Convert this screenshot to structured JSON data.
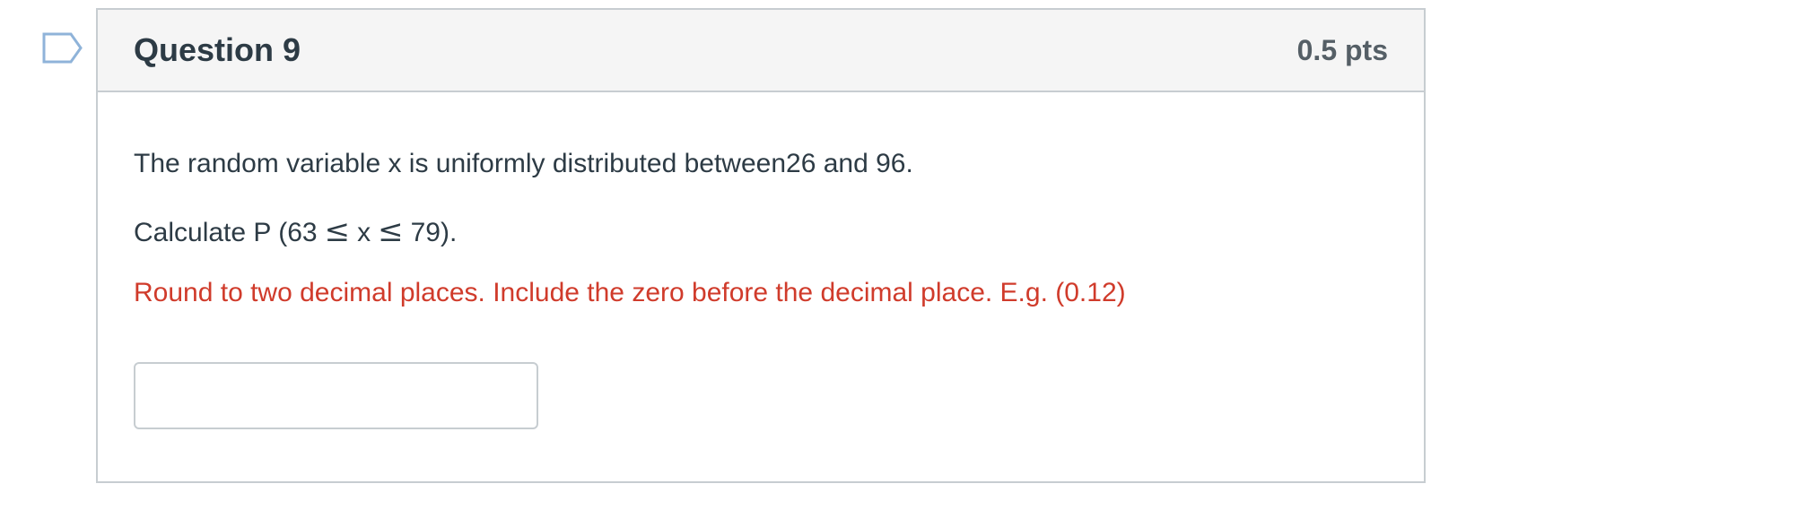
{
  "question": {
    "title": "Question 9",
    "points": "0.5 pts",
    "prompt_line": "The random variable x is uniformly distributed between26 and 96.",
    "calc_prefix": "Calculate P (63",
    "calc_var": "x",
    "calc_suffix": "79).",
    "le_symbol": "≤",
    "instruction": "Round to two decimal places. Include the zero before the decimal place. E.g. (0.12)",
    "answer": {
      "value": "",
      "placeholder": ""
    }
  },
  "icons": {
    "flag": "bookmark-flag-icon"
  },
  "colors": {
    "header_bg": "#f5f5f5",
    "border": "#c7cdd1",
    "text": "#2d3b45",
    "instruction": "#d03b2b",
    "flag": "#8fb3d9"
  }
}
